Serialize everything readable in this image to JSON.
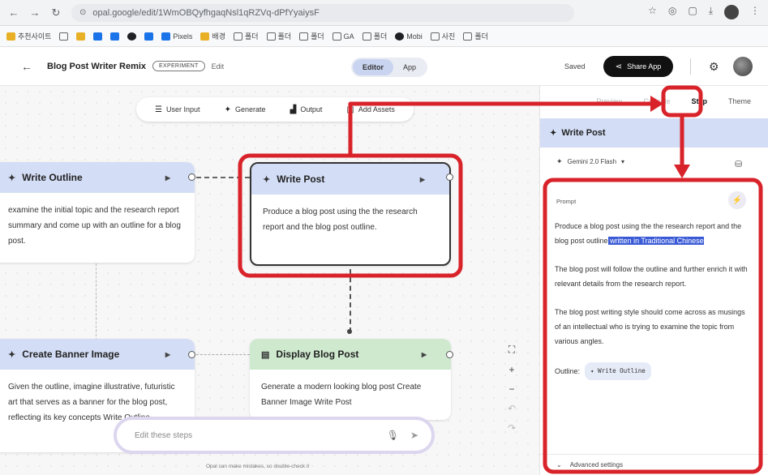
{
  "browser": {
    "url": "opal.google/edit/1WmOBQyfhgaqNsl1qRZVq-dPfYyaiysF",
    "bookmarks": [
      "추천사이트",
      "",
      "",
      "",
      "",
      "",
      "",
      "Pixels",
      "배경",
      "폴더",
      "폴더",
      "폴더",
      "GA",
      "폴더",
      "Mobi",
      "사진",
      "폴더"
    ]
  },
  "header": {
    "app_title": "Blog Post Writer Remix",
    "badge": "EXPERIMENT",
    "edit_label": "Edit",
    "mode_tabs": [
      "Editor",
      "App"
    ],
    "saved": "Saved",
    "share_label": "Share App"
  },
  "toolbar": {
    "items": [
      "User Input",
      "Generate",
      "Output",
      "Add Assets"
    ]
  },
  "nodes": {
    "write_outline": {
      "title": "Write Outline",
      "body": "examine the initial topic and the research report summary and come up with an outline for a blog post."
    },
    "write_post": {
      "title": "Write Post",
      "body": "Produce a blog post using the the research report and the blog post outline."
    },
    "create_banner": {
      "title": "Create Banner Image",
      "body": "Given the outline, imagine illustrative, futuristic art that serves as a banner for the blog post, reflecting its key concepts Write Outline"
    },
    "display_blog": {
      "title": "Display Blog Post",
      "body": "Generate a modern looking blog post Create Banner Image Write Post"
    }
  },
  "chat": {
    "placeholder": "Edit these steps",
    "footnote": "Opal can make mistakes, so double-check it"
  },
  "panel": {
    "tabs": [
      "Preview",
      "Console",
      "Step",
      "Theme"
    ],
    "step_title": "Write Post",
    "model": "Gemini 2.0 Flash",
    "prompt_label": "Prompt",
    "prompt_p1_plain": "Produce a blog post using the the research report and the blog post outline",
    "prompt_p1_highlight": " written in Traditional Chinese",
    "prompt_p2": "The blog post will follow the outline and further enrich it with relevant details from the research report.",
    "prompt_p3": "The blog post writing style should come across as musings of an intellectual who is trying to examine the topic from various angles.",
    "outline_label": "Outline:",
    "outline_chip": "Write Outline",
    "advanced_label": "Advanced settings"
  },
  "colors": {
    "annotation_red": "#d9232a",
    "node_blue": "#d3ddf5",
    "node_green": "#cfe9cf",
    "highlight": "#3b5bd6"
  }
}
